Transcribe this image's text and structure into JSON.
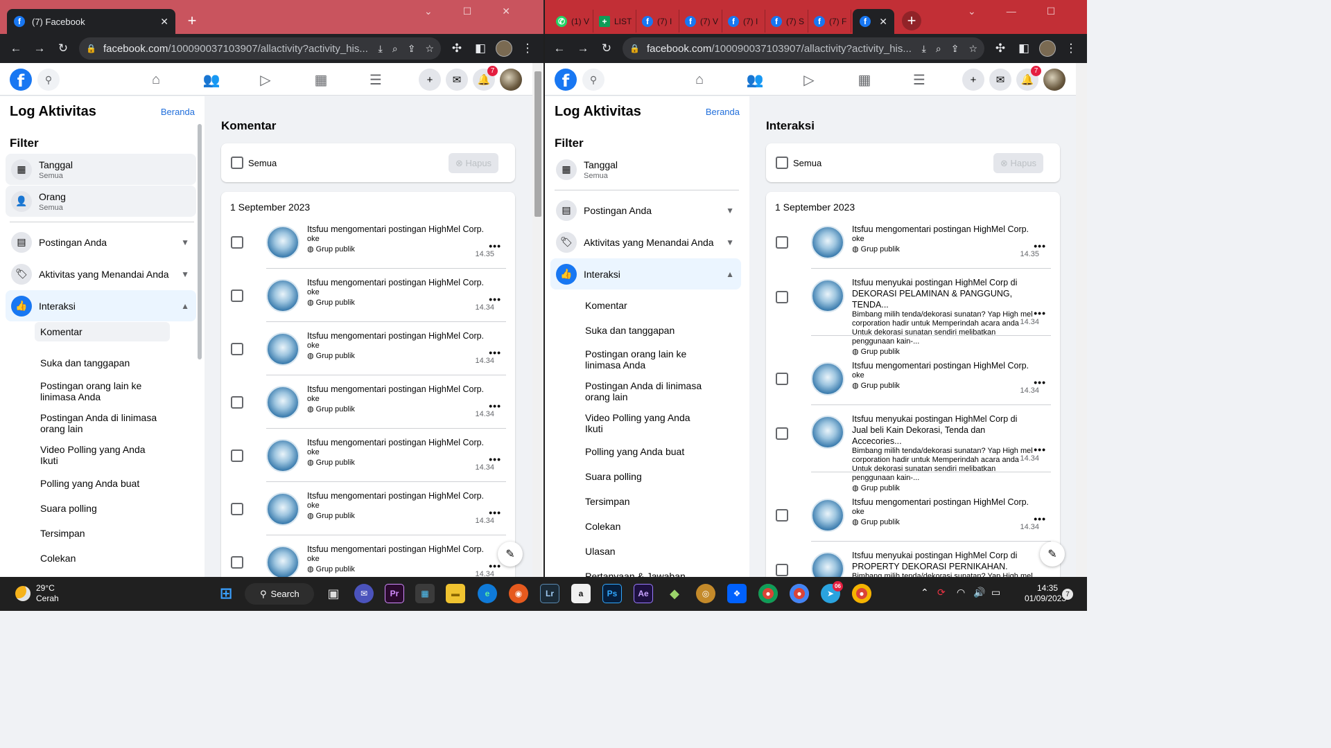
{
  "left_window": {
    "tab_title": "(7) Facebook",
    "url_domain": "facebook.com",
    "url_path": "/100090037103907/allactivity?activity_his...",
    "badge_count": "7",
    "sidebar": {
      "title": "Log Aktivitas",
      "home_link": "Beranda",
      "filter_label": "Filter",
      "filters": [
        {
          "label": "Tanggal",
          "value": "Semua"
        },
        {
          "label": "Orang",
          "value": "Semua"
        }
      ],
      "sections": [
        {
          "label": "Postingan Anda"
        },
        {
          "label": "Aktivitas yang Menandai Anda"
        },
        {
          "label": "Interaksi"
        }
      ],
      "sub_items": [
        "Komentar",
        "Suka dan tanggapan",
        "Postingan orang lain ke linimasa Anda",
        "Postingan Anda di linimasa orang lain",
        "Video Polling yang Anda Ikuti",
        "Polling yang Anda buat",
        "Suara polling",
        "Tersimpan",
        "Colekan"
      ]
    },
    "main": {
      "title": "Komentar",
      "select_all": "Semua",
      "delete_button": "Hapus",
      "date": "1 September 2023",
      "items": [
        {
          "user": "Itsfuu",
          "action": "mengomentari postingan",
          "target": "HighMel Corp.",
          "comment": "oke",
          "privacy": "Grup publik",
          "time": "14.35"
        },
        {
          "user": "Itsfuu",
          "action": "mengomentari postingan",
          "target": "HighMel Corp.",
          "comment": "oke",
          "privacy": "Grup publik",
          "time": "14.34"
        },
        {
          "user": "Itsfuu",
          "action": "mengomentari postingan",
          "target": "HighMel Corp.",
          "comment": "oke",
          "privacy": "Grup publik",
          "time": "14.34"
        },
        {
          "user": "Itsfuu",
          "action": "mengomentari postingan",
          "target": "HighMel Corp.",
          "comment": "oke",
          "privacy": "Grup publik",
          "time": "14.34"
        },
        {
          "user": "Itsfuu",
          "action": "mengomentari postingan",
          "target": "HighMel Corp.",
          "comment": "oke",
          "privacy": "Grup publik",
          "time": "14.34"
        },
        {
          "user": "Itsfuu",
          "action": "mengomentari postingan",
          "target": "HighMel Corp.",
          "comment": "oke",
          "privacy": "Grup publik",
          "time": "14.34"
        },
        {
          "user": "Itsfuu",
          "action": "mengomentari postingan",
          "target": "HighMel Corp.",
          "comment": "oke",
          "privacy": "Grup publik",
          "time": "14.34"
        }
      ]
    }
  },
  "right_window": {
    "tabs": [
      "(1) V",
      "LIST",
      "(7) I",
      "(7) V",
      "(7) I",
      "(7) S",
      "(7) F"
    ],
    "url_domain": "facebook.com",
    "url_path": "/100090037103907/allactivity?activity_his...",
    "badge_count": "7",
    "sidebar": {
      "title": "Log Aktivitas",
      "home_link": "Beranda",
      "filter_label": "Filter",
      "filters": [
        {
          "label": "Tanggal",
          "value": "Semua"
        }
      ],
      "sections": [
        {
          "label": "Postingan Anda"
        },
        {
          "label": "Aktivitas yang Menandai Anda"
        },
        {
          "label": "Interaksi"
        }
      ],
      "sub_items": [
        "Komentar",
        "Suka dan tanggapan",
        "Postingan orang lain ke linimasa Anda",
        "Postingan Anda di linimasa orang lain",
        "Video Polling yang Anda Ikuti",
        "Polling yang Anda buat",
        "Suara polling",
        "Tersimpan",
        "Colekan",
        "Ulasan",
        "Pertanyaan & Jawaban"
      ]
    },
    "main": {
      "title": "Interaksi",
      "select_all": "Semua",
      "delete_button": "Hapus",
      "date": "1 September 2023",
      "items": [
        {
          "user": "Itsfuu",
          "action": "mengomentari postingan",
          "target": "HighMel Corp.",
          "suffix": "",
          "comment": "oke",
          "privacy": "Grup publik",
          "time": "14.35"
        },
        {
          "user": "Itsfuu",
          "action": "menyukai postingan",
          "target": "HighMel Corp",
          "suffix": " di DEKORASI PELAMINAN & PANGGUNG, TENDA...",
          "comment": "Bimbang milih tenda/dekorasi sunatan? Yap High mel corporation hadir untuk Memperindah acara anda Untuk dekorasi sunatan sendiri melibatkan penggunaan kain-...",
          "privacy": "Grup publik",
          "time": "14.34"
        },
        {
          "user": "Itsfuu",
          "action": "mengomentari postingan",
          "target": "HighMel Corp.",
          "suffix": "",
          "comment": "oke",
          "privacy": "Grup publik",
          "time": "14.34"
        },
        {
          "user": "Itsfuu",
          "action": "menyukai postingan",
          "target": "HighMel Corp",
          "suffix": " di Jual beli Kain Dekorasi, Tenda dan Accecories...",
          "comment": "Bimbang milih tenda/dekorasi sunatan? Yap High mel corporation hadir untuk Memperindah acara anda Untuk dekorasi sunatan sendiri melibatkan penggunaan kain-...",
          "privacy": "Grup publik",
          "time": "14.34"
        },
        {
          "user": "Itsfuu",
          "action": "mengomentari postingan",
          "target": "HighMel Corp.",
          "suffix": "",
          "comment": "oke",
          "privacy": "Grup publik",
          "time": "14.34"
        },
        {
          "user": "Itsfuu",
          "action": "menyukai postingan",
          "target": "HighMel Corp",
          "suffix": " di PROPERTY DEKORASI PERNIKAHAN.",
          "comment": "Bimbang milih tenda/dekorasi sunatan? Yap High mel",
          "privacy": "",
          "time": ""
        }
      ]
    }
  },
  "taskbar": {
    "temperature": "29°C",
    "weather": "Cerah",
    "search_label": "Search",
    "time": "14:35",
    "date": "01/09/2023",
    "notification_count": "7",
    "telegram_badge": "06"
  }
}
